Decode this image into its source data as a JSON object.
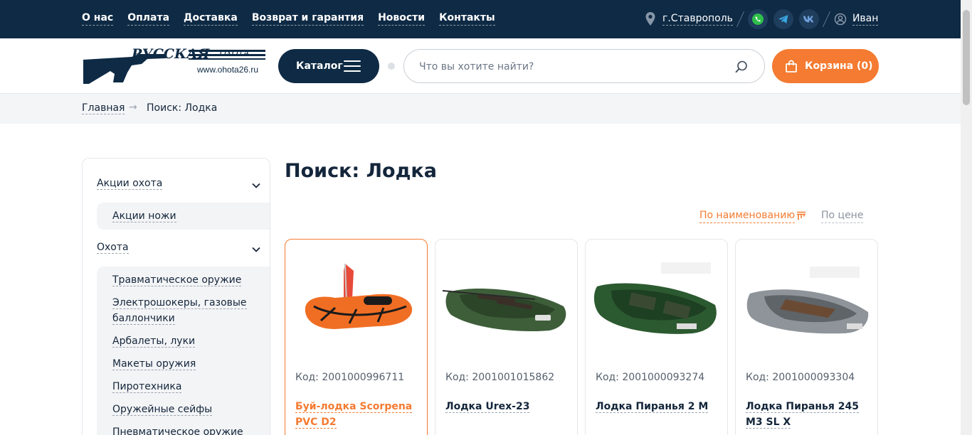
{
  "topnav": {
    "links": [
      "О нас",
      "Оплата",
      "Доставка",
      "Возврат и гарантия",
      "Новости",
      "Контакты"
    ],
    "city": "г.Ставрополь",
    "user": "Иван",
    "socials": [
      "whatsapp-icon",
      "telegram-icon",
      "vk-icon"
    ]
  },
  "header": {
    "logo_domain": "www.ohota26.ru",
    "logo_text": "РУССКАЯ ОХОТА",
    "catalog_label": "Каталог",
    "search_placeholder": "Что вы хотите найти?",
    "cart_label": "Корзина (0)"
  },
  "breadcrumb": {
    "home": "Главная",
    "current": "Поиск: Лодка"
  },
  "sidebar": {
    "groups": [
      {
        "label": "Акции охота",
        "items": [
          "Акции ножи"
        ]
      },
      {
        "label": "Охота",
        "items": [
          "Травматическое оружие",
          "Электрошокеры, газовые баллончики",
          "Арбалеты, луки",
          "Макеты оружия",
          "Пиротехника",
          "Оружейные сейфы",
          "Пневматическое оружие"
        ]
      }
    ]
  },
  "main": {
    "title": "Поиск: Лодка",
    "sort_by_name": "По наименованию",
    "sort_by_price": "По цене"
  },
  "products": [
    {
      "code": "Код: 2001000996711",
      "name": "Буй-лодка Scorpena PVC D2",
      "color": "orange"
    },
    {
      "code": "Код: 2001001015862",
      "name": "Лодка Urex-23",
      "color": "dark-green"
    },
    {
      "code": "Код: 2001000093274",
      "name": "Лодка Пиранья 2 М",
      "color": "green"
    },
    {
      "code": "Код: 2001000093304",
      "name": "Лодка Пиранья 245 М3 SL X",
      "color": "grey"
    }
  ],
  "colors": {
    "navy": "#0e2a45",
    "accent": "#f47b31",
    "text": "#14263b"
  }
}
